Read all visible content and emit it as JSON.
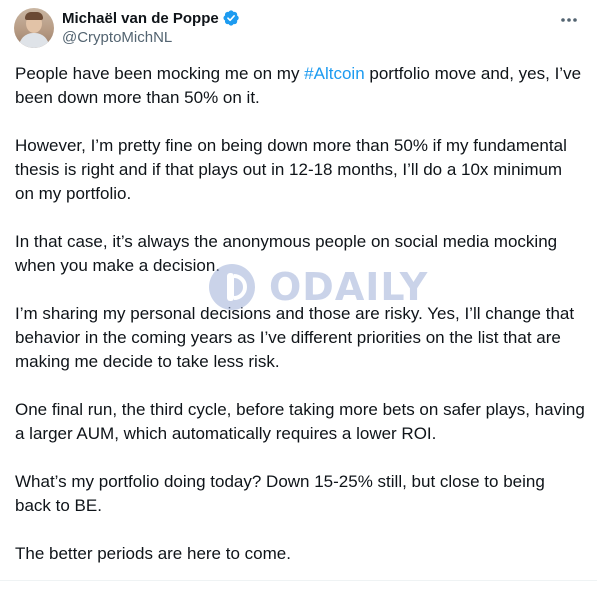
{
  "author": {
    "display_name": "Michaël van de Poppe",
    "handle": "@CryptoMichNL",
    "verified": true,
    "accent_color": "#1d9bf0"
  },
  "menu": {
    "icon": "more-horizontal-icon"
  },
  "tweet": {
    "p1_before": "People have been mocking me on my ",
    "p1_hashtag": "#Altcoin",
    "p1_after": " portfolio move and, yes, I’ve been down more than 50% on it.",
    "p2": "However, I’m pretty fine on being down more than 50% if my fundamental thesis is right and if that plays out in 12-18 months, I’ll do a 10x minimum on my portfolio.",
    "p3": "In that case, it’s always the anonymous people on social media mocking when you make a decision.",
    "p4": "I’m sharing my personal decisions and those are risky. Yes, I’ll change that behavior in the coming years as I’ve different priorities on the list that are making me decide to take less risk.",
    "p5": "One final run, the third cycle, before taking more bets on safer plays, having a larger AUM, which automatically requires a lower ROI.",
    "p6": "What’s my portfolio doing today? Down 15-25% still, but close to being back to BE.",
    "p7": "The better periods are here to come."
  },
  "watermark": {
    "text": "ODAILY",
    "color": "#9fb0d8"
  }
}
